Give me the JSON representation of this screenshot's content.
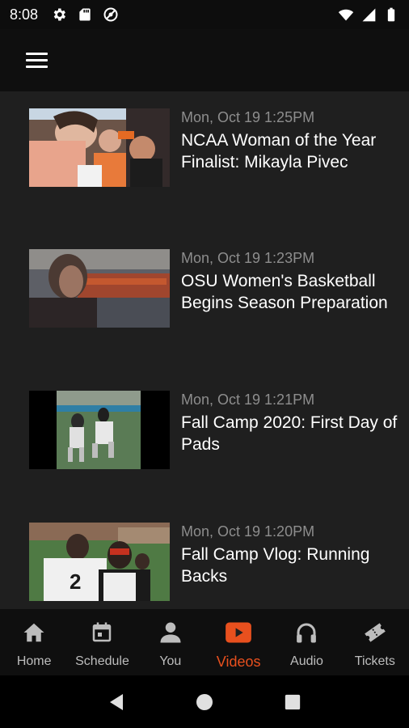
{
  "status_bar": {
    "time": "8:08",
    "left_icons": [
      "settings-gear-icon",
      "sd-card-icon",
      "do-not-disturb-icon"
    ],
    "right_icons": [
      "wifi-icon",
      "signal-icon",
      "battery-icon"
    ]
  },
  "app_bar": {
    "menu_icon": "hamburger-menu-icon"
  },
  "videos": [
    {
      "date": "Mon, Oct 19 1:25PM",
      "title": "NCAA Woman of the Year Finalist: Mikayla Pivec"
    },
    {
      "date": "Mon, Oct 19 1:23PM",
      "title": "OSU Women's Basketball Begins Season Preparation"
    },
    {
      "date": "Mon, Oct 19 1:21PM",
      "title": "Fall Camp 2020: First Day of Pads"
    },
    {
      "date": "Mon, Oct 19 1:20PM",
      "title": "Fall Camp Vlog: Running Backs"
    }
  ],
  "bottom_nav": {
    "items": [
      {
        "label": "Home",
        "icon": "home-icon"
      },
      {
        "label": "Schedule",
        "icon": "calendar-icon"
      },
      {
        "label": "You",
        "icon": "person-icon"
      },
      {
        "label": "Videos",
        "icon": "play-video-icon"
      },
      {
        "label": "Audio",
        "icon": "headphones-icon"
      },
      {
        "label": "Tickets",
        "icon": "ticket-icon"
      }
    ],
    "active": "Videos"
  },
  "system_nav": [
    "back-icon",
    "home-circle-icon",
    "recents-icon"
  ],
  "colors": {
    "accent": "#e8501e",
    "background": "#1f1f1f",
    "bar": "#0f0f0f",
    "date_text": "#8d8d8d",
    "inactive_label": "#bdbdbd"
  }
}
